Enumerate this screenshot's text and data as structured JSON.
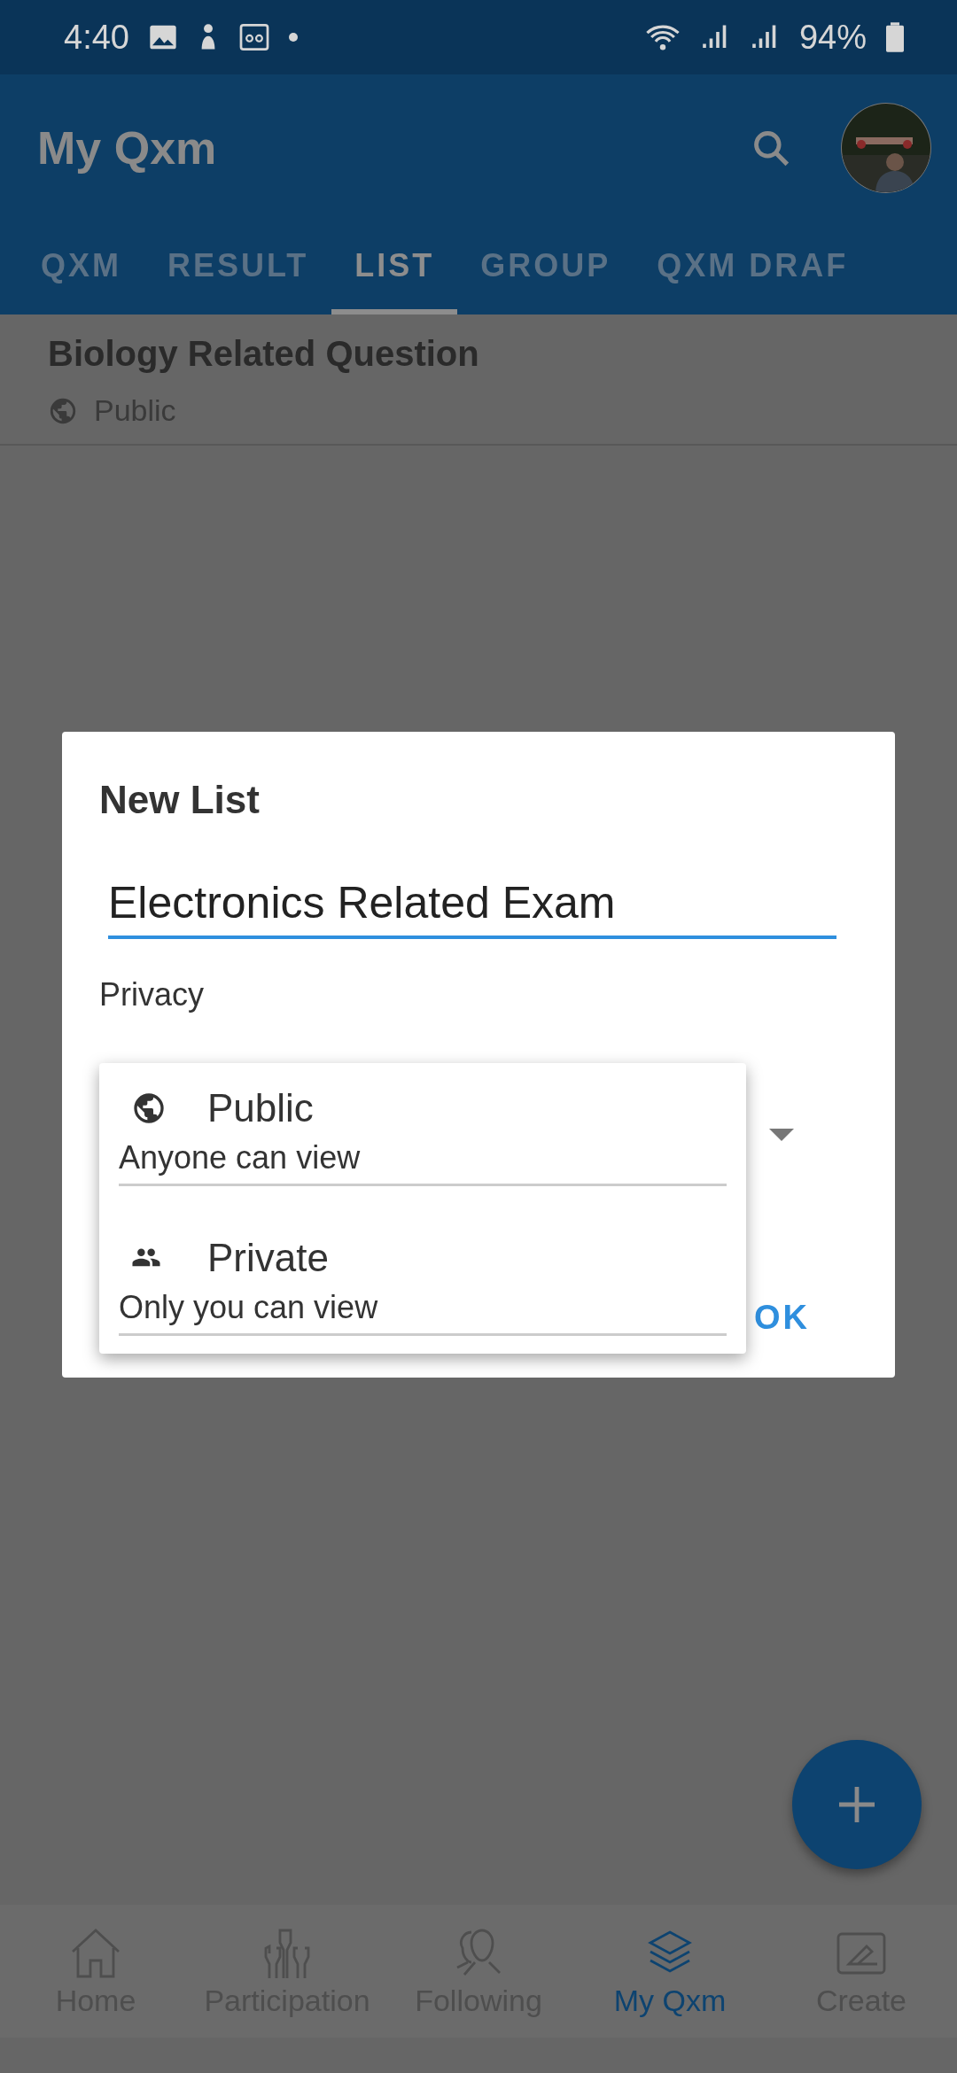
{
  "status_bar": {
    "time": "4:40",
    "battery": "94%"
  },
  "app_bar": {
    "title": "My Qxm"
  },
  "tabs": [
    {
      "label": "QXM",
      "selected": false
    },
    {
      "label": "RESULT",
      "selected": false
    },
    {
      "label": "LIST",
      "selected": true
    },
    {
      "label": "GROUP",
      "selected": false
    },
    {
      "label": "QXM DRAF",
      "selected": false
    }
  ],
  "lists": [
    {
      "title": "Biology Related Question",
      "privacy": "Public"
    }
  ],
  "dialog": {
    "title": "New List",
    "name_value": "Electronics Related Exam",
    "privacy_label": "Privacy",
    "buttons": [
      "OK"
    ],
    "options": [
      {
        "kind": "public",
        "label": "Public",
        "description": "Anyone can view"
      },
      {
        "kind": "private",
        "label": "Private",
        "description": "Only you can view"
      }
    ]
  },
  "bottom_nav": [
    {
      "kind": "home",
      "label": "Home",
      "selected": false
    },
    {
      "kind": "participation",
      "label": "Participation",
      "selected": false
    },
    {
      "kind": "following",
      "label": "Following",
      "selected": false
    },
    {
      "kind": "myqxm",
      "label": "My Qxm",
      "selected": true
    },
    {
      "kind": "create",
      "label": "Create",
      "selected": false
    }
  ]
}
